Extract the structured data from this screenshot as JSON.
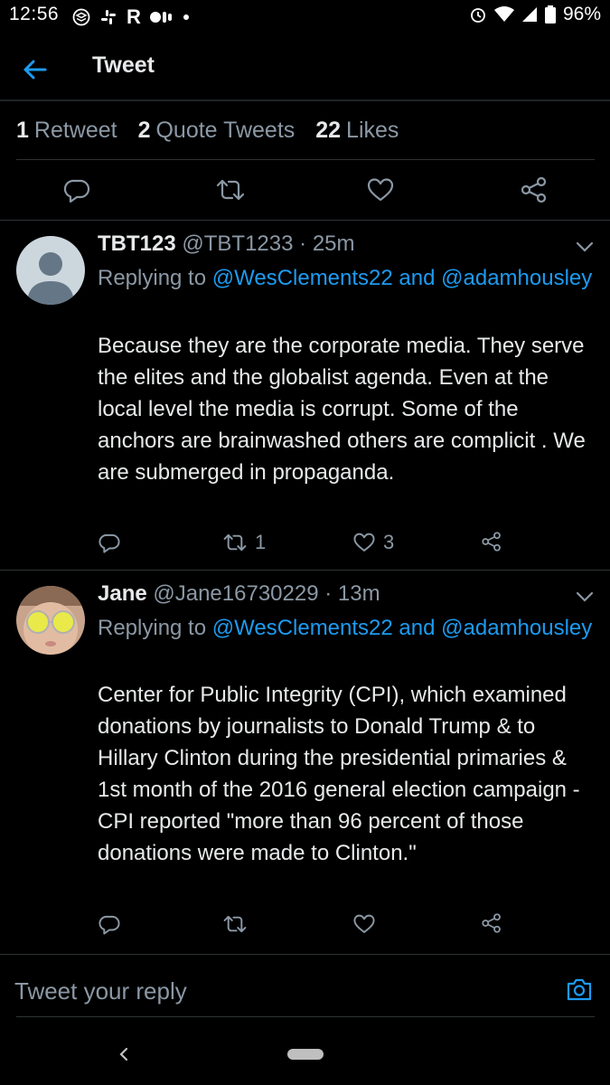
{
  "status_bar": {
    "time": "12:56",
    "left_icons": [
      "stack-icon",
      "slack-icon",
      "reddit-icon",
      "dots-icon",
      "dot-icon"
    ],
    "right_icons": [
      "alarm-icon",
      "wifi-icon",
      "signal-icon",
      "battery-icon"
    ],
    "battery": "96%"
  },
  "header": {
    "title": "Tweet",
    "back_icon": "arrow-left-icon"
  },
  "stats": {
    "retweets": {
      "count": "1",
      "label": "Retweet"
    },
    "quotes": {
      "count": "2",
      "label": "Quote Tweets"
    },
    "likes": {
      "count": "22",
      "label": "Likes"
    }
  },
  "actions": [
    "reply-icon",
    "retweet-icon",
    "like-icon",
    "share-icon"
  ],
  "replies": [
    {
      "name": "TBT123",
      "handle": "@TBT1233",
      "separator": "·",
      "time": "25m",
      "replying_prefix": "Replying to",
      "mention1": "@WesClements22",
      "conj": "and",
      "mention2": "@adamhousley",
      "text": "Because they are the corporate media. They serve the elites and the globalist agenda. Even at the local level the media is corrupt. Some of the anchors are brainwashed others are complicit . We are submerged in propaganda.",
      "retweet_count": "1",
      "like_count": "3"
    },
    {
      "name": "Jane",
      "handle": "@Jane16730229",
      "separator": "·",
      "time": "13m",
      "replying_prefix": "Replying to",
      "mention1": "@WesClements22",
      "conj": "and",
      "mention2": "@adamhousley",
      "text": "Center for Public Integrity (CPI), which examined donations by journalists to Donald Trump & to Hillary Clinton during the presidential primaries & 1st month of the 2016 general election campaign - CPI reported \"more than 96 percent of those donations were made to Clinton.\"",
      "retweet_count": "",
      "like_count": ""
    }
  ],
  "reply_box": {
    "placeholder": "Tweet your reply"
  },
  "colors": {
    "background": "#000000",
    "text": "#e7e9ea",
    "muted": "#8b98a5",
    "accent": "#1d9bf0",
    "divider": "#2f3336"
  }
}
